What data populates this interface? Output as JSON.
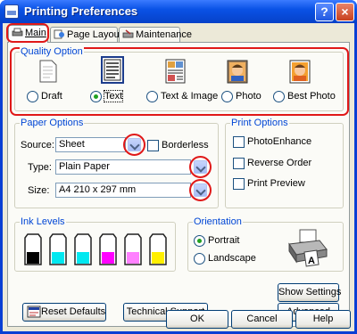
{
  "window": {
    "title": "Printing Preferences",
    "help_label": "?",
    "close_label": "×"
  },
  "tabs": [
    {
      "label": "Main"
    },
    {
      "label": "Page Layout"
    },
    {
      "label": "Maintenance"
    }
  ],
  "quality": {
    "group_label": "Quality Option",
    "selected": "Text",
    "options": [
      {
        "label": "Draft",
        "icon": "draft-page-icon"
      },
      {
        "label": "Text",
        "icon": "text-page-icon"
      },
      {
        "label": "Text & Image",
        "icon": "text-image-page-icon"
      },
      {
        "label": "Photo",
        "icon": "photo-icon"
      },
      {
        "label": "Best Photo",
        "icon": "best-photo-icon"
      }
    ]
  },
  "paper": {
    "group_label": "Paper Options",
    "source_label": "Source:",
    "source_value": "Sheet",
    "borderless_label": "Borderless",
    "type_label": "Type:",
    "type_value": "Plain Paper",
    "size_label": "Size:",
    "size_value": "A4 210 x 297 mm"
  },
  "print_options": {
    "group_label": "Print Options",
    "photo_enhance": "PhotoEnhance",
    "reverse_order": "Reverse Order",
    "print_preview": "Print Preview"
  },
  "ink": {
    "group_label": "Ink Levels",
    "colors": [
      "#000000",
      "#00e8f0",
      "#00e8f0",
      "#ff00ff",
      "#ff80ff",
      "#ffef00"
    ]
  },
  "orientation": {
    "group_label": "Orientation",
    "portrait": "Portrait",
    "landscape": "Landscape",
    "selected": "Portrait"
  },
  "buttons": {
    "show_settings": "Show Settings",
    "reset_defaults": "Reset Defaults",
    "technical_support": "Technical Support",
    "advanced": "Advanced",
    "ok": "OK",
    "cancel": "Cancel",
    "help": "Help"
  },
  "colors": {
    "highlight": "#e01818",
    "accent": "#0046d5"
  }
}
